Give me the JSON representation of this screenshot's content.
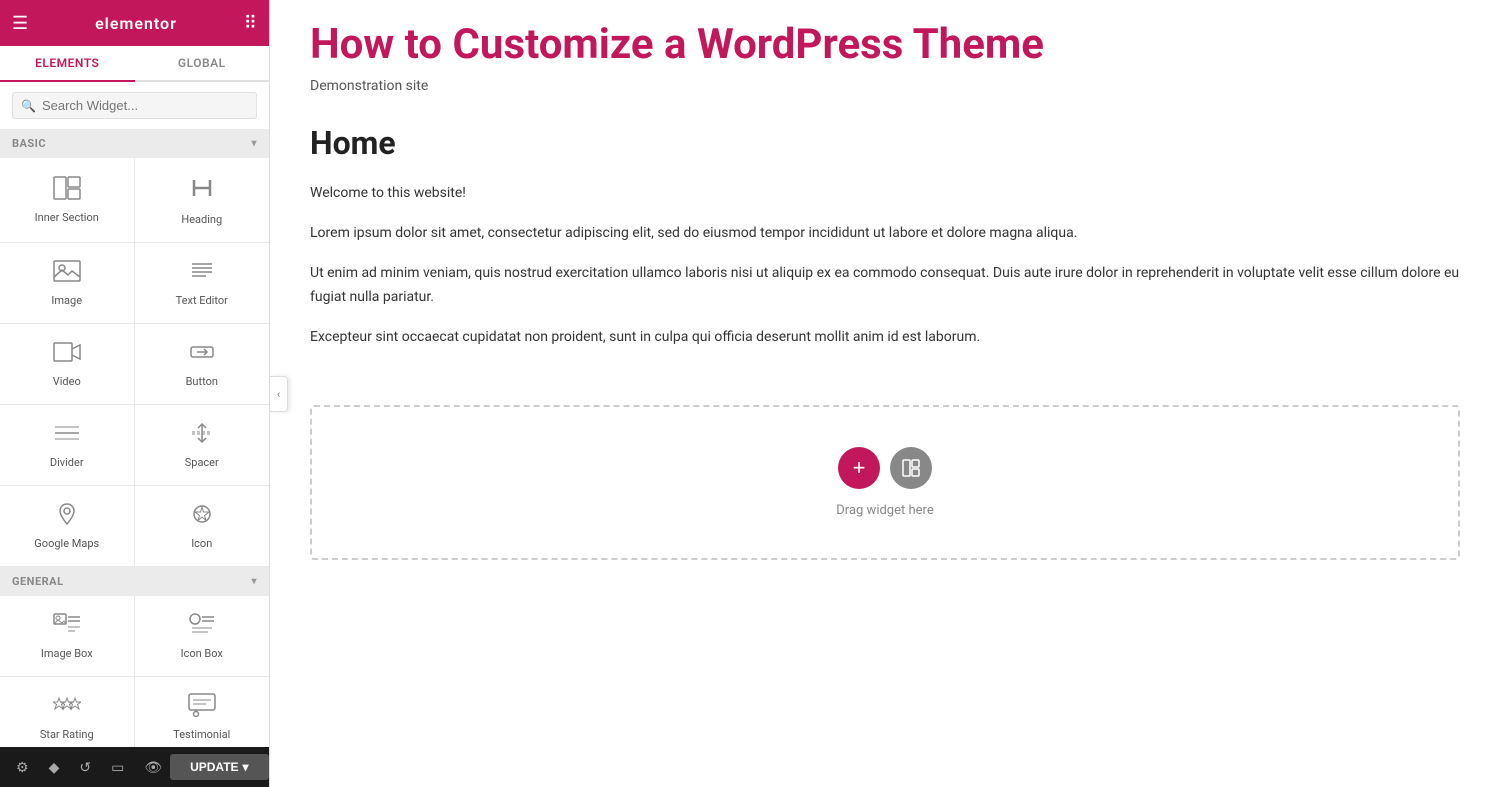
{
  "sidebar": {
    "logo": "elementor",
    "tabs": [
      {
        "label": "ELEMENTS",
        "active": true
      },
      {
        "label": "GLOBAL",
        "active": false
      }
    ],
    "search_placeholder": "Search Widget...",
    "sections": [
      {
        "name": "BASIC",
        "expanded": true,
        "widgets": [
          {
            "id": "inner-section",
            "label": "Inner Section",
            "icon": "icon-inner-section"
          },
          {
            "id": "heading",
            "label": "Heading",
            "icon": "icon-heading"
          },
          {
            "id": "image",
            "label": "Image",
            "icon": "icon-image"
          },
          {
            "id": "text-editor",
            "label": "Text Editor",
            "icon": "icon-text-editor"
          },
          {
            "id": "video",
            "label": "Video",
            "icon": "icon-video"
          },
          {
            "id": "button",
            "label": "Button",
            "icon": "icon-button"
          },
          {
            "id": "divider",
            "label": "Divider",
            "icon": "icon-divider"
          },
          {
            "id": "spacer",
            "label": "Spacer",
            "icon": "icon-spacer"
          },
          {
            "id": "google-maps",
            "label": "Google Maps",
            "icon": "icon-google-maps"
          },
          {
            "id": "icon",
            "label": "Icon",
            "icon": "icon-icon"
          }
        ]
      },
      {
        "name": "GENERAL",
        "expanded": true,
        "widgets": [
          {
            "id": "image-box",
            "label": "Image Box",
            "icon": "icon-image-box"
          },
          {
            "id": "icon-box",
            "label": "Icon Box",
            "icon": "icon-icon-box"
          },
          {
            "id": "star-rating",
            "label": "Star Rating",
            "icon": "icon-star-rating"
          },
          {
            "id": "testimonial",
            "label": "Testimonial",
            "icon": "icon-testimonial"
          }
        ]
      }
    ],
    "bottom_toolbar": {
      "tools": [
        "settings",
        "style",
        "history",
        "responsive",
        "preview"
      ],
      "update_label": "UPDATE",
      "update_arrow": "▾"
    }
  },
  "canvas": {
    "site_title": "How to Customize a WordPress Theme",
    "site_subtitle": "Demonstration site",
    "page_heading": "Home",
    "paragraphs": [
      "Welcome to this website!",
      "Lorem ipsum dolor sit amet, consectetur adipiscing elit, sed do eiusmod tempor incididunt ut labore et dolore magna aliqua.",
      "Ut enim ad minim veniam, quis nostrud exercitation ullamco laboris nisi ut aliquip ex ea commodo consequat. Duis aute irure dolor in reprehenderit in voluptate velit esse cillum dolore eu fugiat nulla pariatur.",
      "Excepteur sint occaecat cupidatat non proident, sunt in culpa qui officia deserunt mollit anim id est laborum."
    ],
    "drop_zone_label": "Drag widget here"
  }
}
